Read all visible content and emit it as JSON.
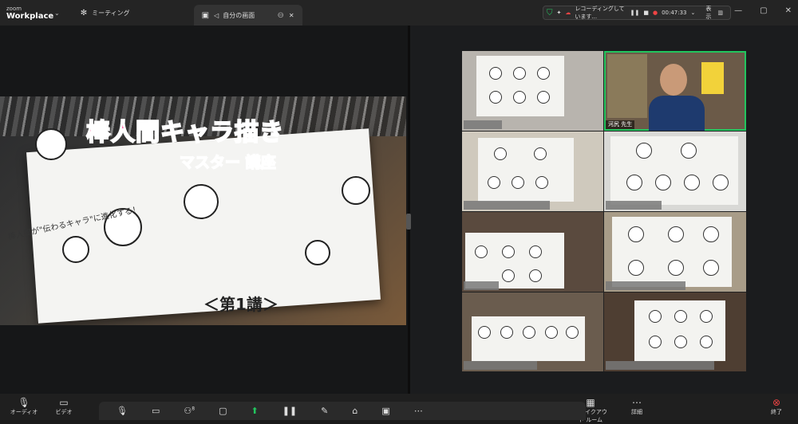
{
  "titlebar": {
    "brand_small": "zoom",
    "brand_main": "Workplace",
    "tab_meeting": "ミーティング",
    "tab_share": "自分の画面",
    "recording_text": "レコーディングしています...",
    "timer": "00:47:33",
    "view_label": "表示"
  },
  "slide": {
    "title": "棒人間キャラ描き",
    "subtitle": "マスター 講座",
    "curve_text": "棒人間が\"伝わるキャラ\"に進化する！",
    "lecture": "＜第1講＞"
  },
  "gallery": {
    "speaker_name": "河尻 先生"
  },
  "toolbar": {
    "audio": "オーディオ",
    "video": "ビデオ",
    "breakout": "ブレイクアウト ルーム",
    "details": "詳細",
    "end": "終了",
    "participants_count": "8"
  },
  "colors": {
    "accent_green": "#22c55e",
    "record_red": "#ef4444",
    "title_pink": "#ff2d87"
  }
}
